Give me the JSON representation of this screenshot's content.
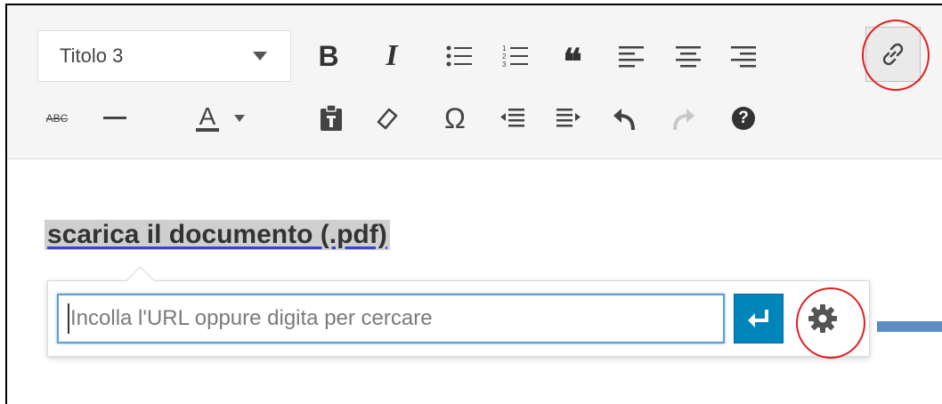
{
  "toolbar": {
    "format_select": {
      "value": "Titolo 3"
    },
    "row1": [
      {
        "name": "bold",
        "glyph": "B"
      },
      {
        "name": "italic",
        "glyph": "I"
      },
      {
        "name": "bullet-list"
      },
      {
        "name": "numbered-list"
      },
      {
        "name": "blockquote",
        "glyph": "❝"
      },
      {
        "name": "align-left"
      },
      {
        "name": "align-center"
      },
      {
        "name": "align-right"
      },
      {
        "name": "insert-link",
        "active": true
      }
    ],
    "row2": [
      {
        "name": "strikethrough",
        "glyph": "ABC"
      },
      {
        "name": "horizontal-line"
      },
      {
        "name": "text-color",
        "glyph": "A"
      },
      {
        "name": "paste-as-text"
      },
      {
        "name": "clear-formatting"
      },
      {
        "name": "special-character",
        "glyph": "Ω"
      },
      {
        "name": "outdent"
      },
      {
        "name": "indent"
      },
      {
        "name": "undo"
      },
      {
        "name": "redo"
      },
      {
        "name": "help",
        "glyph": "?"
      }
    ]
  },
  "editor": {
    "heading_text": "scarica il documento (.pdf)"
  },
  "link_popup": {
    "placeholder": "Incolla l'URL oppure digita per cercare",
    "value": ""
  },
  "colors": {
    "annotation_circle": "#e01f1f",
    "apply_button": "#0085ba",
    "input_focus": "#5b9dd9",
    "pointer_arrow": "#5b8ec4"
  }
}
